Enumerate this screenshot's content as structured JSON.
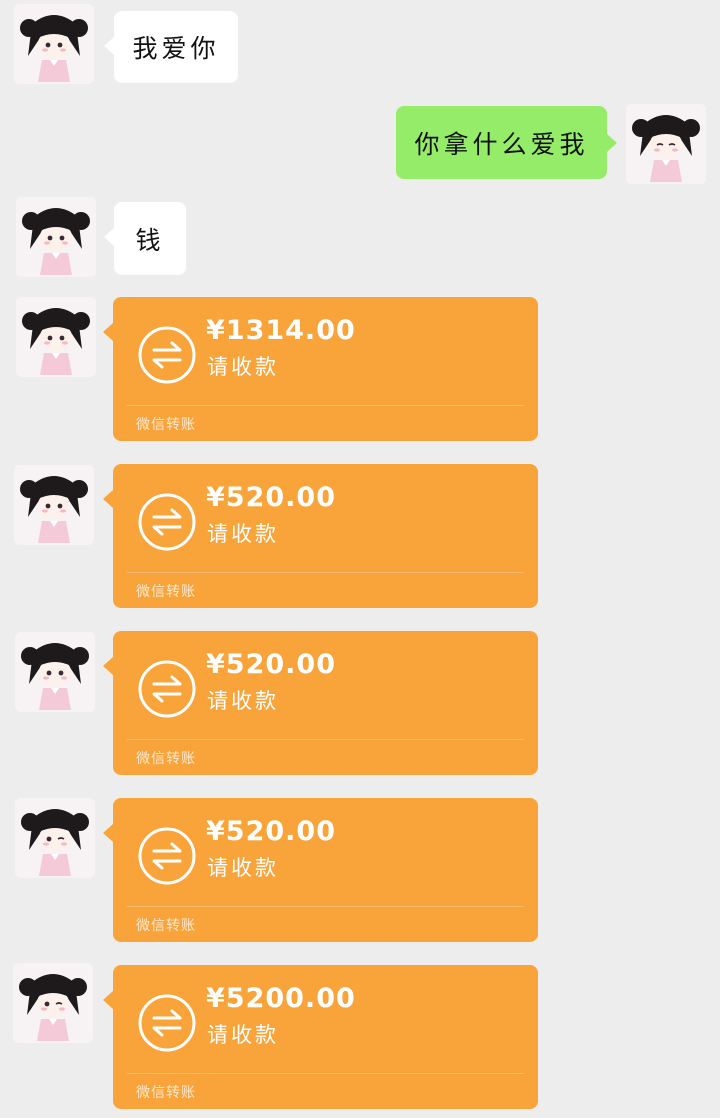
{
  "messages": [
    {
      "side": "left",
      "type": "text",
      "text": "我爱你"
    },
    {
      "side": "right",
      "type": "text",
      "text": "你拿什么爱我"
    },
    {
      "side": "left",
      "type": "text",
      "text": "钱"
    },
    {
      "side": "left",
      "type": "transfer",
      "amount": "¥1314.00",
      "status": "请收款",
      "label": "微信转账"
    },
    {
      "side": "left",
      "type": "transfer",
      "amount": "¥520.00",
      "status": "请收款",
      "label": "微信转账"
    },
    {
      "side": "left",
      "type": "transfer",
      "amount": "¥520.00",
      "status": "请收款",
      "label": "微信转账"
    },
    {
      "side": "left",
      "type": "transfer",
      "amount": "¥520.00",
      "status": "请收款",
      "label": "微信转账"
    },
    {
      "side": "left",
      "type": "transfer",
      "amount": "¥5200.00",
      "status": "请收款",
      "label": "微信转账"
    }
  ],
  "colors": {
    "background": "#ededed",
    "self_bubble": "#95ec69",
    "other_bubble": "#ffffff",
    "transfer_card": "#f9a43b"
  },
  "icons": {
    "avatar": "anime-girl-avatar-icon",
    "transfer": "transfer-arrows-icon"
  }
}
